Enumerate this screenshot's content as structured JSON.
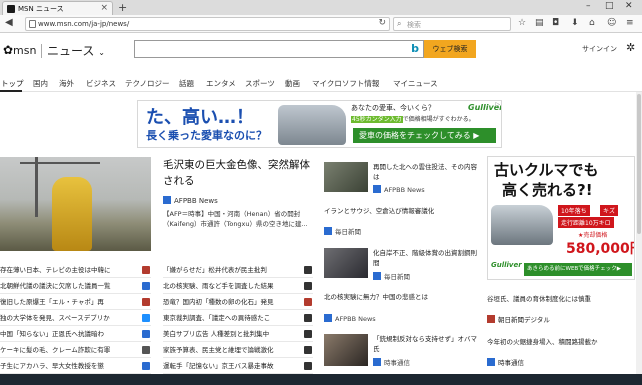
{
  "browser": {
    "tab_title": "MSN ニュース",
    "new_tab": "+",
    "url": "www.msn.com/ja-jp/news/",
    "search_placeholder": "検索",
    "window_controls": [
      "–",
      "□",
      "✕"
    ]
  },
  "header": {
    "logo_text": "msn",
    "section": "ニュース",
    "web_search_button": "ウェブ検索",
    "signin": "サインイン"
  },
  "nav": {
    "items": [
      "トップ",
      "国内",
      "海外",
      "ビジネス",
      "テクノロジー",
      "話題",
      "エンタメ",
      "スポーツ",
      "動画",
      "マイクロソフト情報",
      "マイニュース"
    ]
  },
  "banner_ad": {
    "line1": "た、高い…！",
    "line2": "長く乗った愛車なのに？",
    "text1": "あなたの愛車、今いくら？",
    "text2_highlight": "45秒カンタン入力",
    "text2_rest": "で価格相場がすぐわかる。",
    "cta": "愛車の価格をチェックしてみる ▶",
    "brand": "Gulliver"
  },
  "hero": {
    "title": "毛沢東の巨大金色像、突然解体される",
    "source": "AFPBB News",
    "desc": "【AFP＝時事】中国・河南（Henan）省の開封（Kaifeng）市通許（Tongxu）県の空き地に建..."
  },
  "left_list": [
    {
      "text": "存在薄い日本、テレビの主役は中韓に",
      "icon_color": "#b33b2e"
    },
    {
      "text": "北朝鮮代議の議決に欠席した議員一覧",
      "icon_color": "#2a6bd0"
    },
    {
      "text": "復旧した原爆王「エル・チャポ」再",
      "icon_color": "#b33b2e"
    },
    {
      "text": "独の大学体を発見、スペースデブリか",
      "icon_color": "#1e90ff"
    },
    {
      "text": "中国「知らない」正恩氏へ抗議暗わ",
      "icon_color": "#2a6bd0"
    },
    {
      "text": "ケーキに髪の毛、クレーム詐欺に有罪",
      "icon_color": "#555555"
    },
    {
      "text": "子生にアカハラ、早大女性教授を懲",
      "icon_color": "#2a6bd0"
    }
  ],
  "mid_list": [
    {
      "text": "「嫌がらせだ」松井代表が民主批判",
      "icon_color": "#333333"
    },
    {
      "text": "北の核実験、雨など手を調査した結果",
      "icon_color": "#333333"
    },
    {
      "text": "恐竜？国内初「種数の卵の化石」発見",
      "icon_color": "#b33b2e"
    },
    {
      "text": "東京裁判調査、「議定への異待感たこ",
      "icon_color": "#333333"
    },
    {
      "text": "美白サプリ広告 人種差別と批判集中",
      "icon_color": "#333333"
    },
    {
      "text": "家族予算表、民主党と維埋で論戦激化",
      "icon_color": "#333333"
    },
    {
      "text": "運転手「記憶ない」京王バス暴走事故",
      "icon_color": "#333333"
    }
  ],
  "col3": {
    "story1_title": "再開した北への雲住投法、その内容は",
    "story1_source": "AFPBB News",
    "story2_title": "イランとサウジ、空倉込び情報審議化",
    "story2_source": "毎日新聞",
    "story3_title": "化自岸不正、階級体賞の出資割鋼則間",
    "story3_source": "毎日新聞",
    "story4_title": "北の核実験に無力？中国の悲惑とは",
    "story4_source": "AFPBB News",
    "story5_title": "「銃規制反対なら支持せず」オバマ氏",
    "story5_source": "時事通信"
  },
  "right_ad": {
    "h1": "古いクルマでも",
    "h2": "高く売れる?!",
    "badge1": "10年落ち",
    "badge2": "キズ",
    "badge3": "走行距離10万キロ",
    "sale": "★売却価格",
    "price": "580,000円",
    "brand": "Gulliver",
    "cta": "あきらめる前にWEBで価格チェック▶"
  },
  "right_col": {
    "story1_title": "谷垣氏、議員の育休制度化には慎重",
    "story1_source": "朝日新聞デジタル",
    "story2_title": "今年初の火鋸捷身場入、積闘路揚載か",
    "story2_source": "時事通信"
  },
  "colors": {
    "accent": "#f2a61f",
    "bing_blue": "#0b8eb5",
    "gulliver_green": "#2d8f2a",
    "ad_red": "#d0161c"
  }
}
